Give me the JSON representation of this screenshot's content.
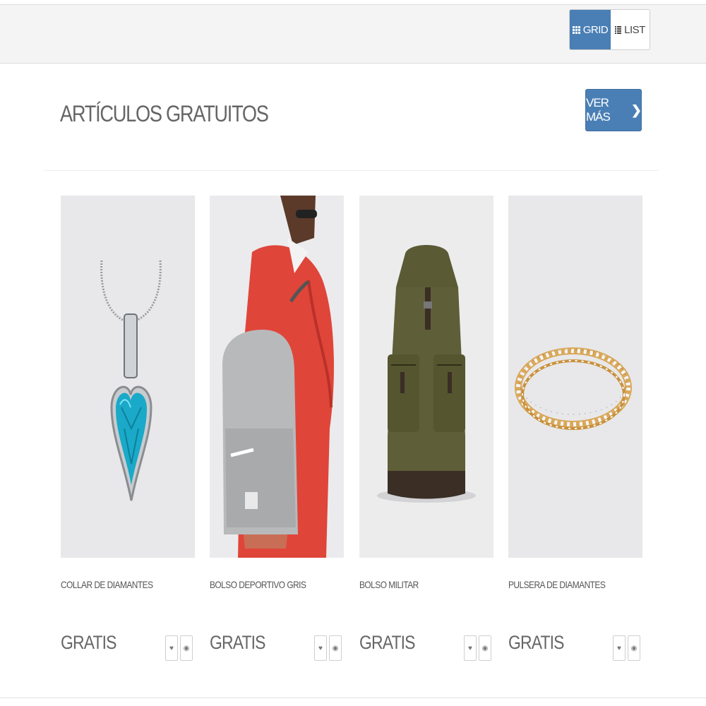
{
  "toolbar": {
    "grid_label": "GRID",
    "list_label": "LIST"
  },
  "section": {
    "title": "ARTÍCULOS GRATUITOS",
    "more_label": "VER MÁS",
    "more_icon": "chevron-right-icon"
  },
  "products": [
    {
      "name": "COLLAR DE DIAMANTES",
      "price": "GRATIS",
      "image": "diamond-necklace"
    },
    {
      "name": "BOLSO DEPORTIVO GRIS",
      "price": "GRATIS",
      "image": "gray-backpack"
    },
    {
      "name": "BOLSO MILITAR",
      "price": "GRATIS",
      "image": "military-bag"
    },
    {
      "name": "PULSERA DE DIAMANTES",
      "price": "GRATIS",
      "image": "diamond-bracelet"
    }
  ],
  "icons": {
    "favorite": "heart-icon",
    "quick_view": "eye-icon"
  },
  "colors": {
    "accent": "#4a7fb5",
    "topbar_bg": "#f4f4f4",
    "image_bg": "#e8e8ea"
  }
}
